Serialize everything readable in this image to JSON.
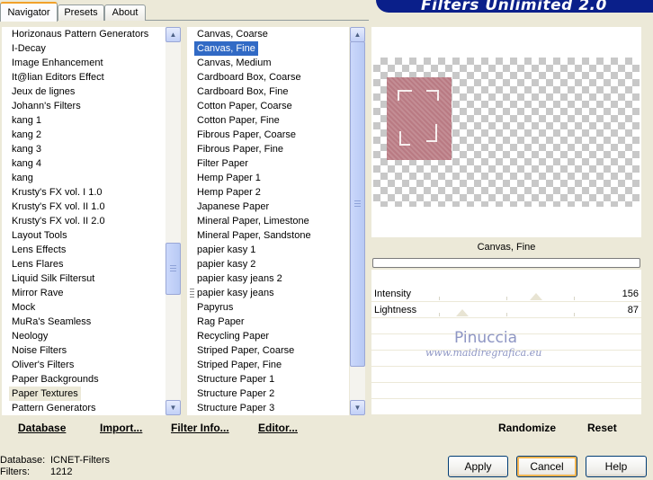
{
  "tabs": [
    {
      "label": "Navigator",
      "active": true
    },
    {
      "label": "Presets",
      "active": false
    },
    {
      "label": "About",
      "active": false
    }
  ],
  "banner_title": "Filters Unlimited 2.0",
  "categories": {
    "items": [
      "Horizonaus Pattern Generators",
      "I-Decay",
      "Image Enhancement",
      "It@lian Editors Effect",
      "Jeux de lignes",
      "Johann's Filters",
      "kang 1",
      "kang 2",
      "kang 3",
      "kang 4",
      "kang",
      "Krusty's FX vol. I 1.0",
      "Krusty's FX vol. II 1.0",
      "Krusty's FX vol. II 2.0",
      "Layout Tools",
      "Lens Effects",
      "Lens Flares",
      "Liquid Silk Filtersut",
      "Mirror Rave",
      "Mock",
      "MuRa's Seamless",
      "Neology",
      "Noise Filters",
      "Oliver's Filters",
      "Paper Backgrounds",
      "Paper Textures",
      "Pattern Generators"
    ],
    "selected": "Paper Textures"
  },
  "filters": {
    "items": [
      "Canvas, Coarse",
      "Canvas, Fine",
      "Canvas, Medium",
      "Cardboard Box, Coarse",
      "Cardboard Box, Fine",
      "Cotton Paper, Coarse",
      "Cotton Paper, Fine",
      "Fibrous Paper, Coarse",
      "Fibrous Paper, Fine",
      "Filter Paper",
      "Hemp Paper 1",
      "Hemp Paper 2",
      "Japanese Paper",
      "Mineral Paper, Limestone",
      "Mineral Paper, Sandstone",
      "papier kasy 1",
      "papier kasy 2",
      "papier kasy jeans 2",
      "papier kasy jeans",
      "Papyrus",
      "Rag Paper",
      "Recycling Paper",
      "Striped Paper, Coarse",
      "Striped Paper, Fine",
      "Structure Paper 1",
      "Structure Paper 2",
      "Structure Paper 3"
    ],
    "selected": "Canvas, Fine"
  },
  "bottom_links": {
    "database": "Database",
    "import": "Import...",
    "filter_info": "Filter Info...",
    "editor": "Editor...",
    "randomize": "Randomize",
    "reset": "Reset"
  },
  "preview": {
    "filter_name": "Canvas, Fine"
  },
  "parameters": [
    {
      "label": "Intensity",
      "value": "156"
    },
    {
      "label": "Lightness",
      "value": "87"
    }
  ],
  "watermark": {
    "name": "Pinuccia",
    "site": "www.maidiregrafica.eu"
  },
  "status": {
    "database_label": "Database:",
    "database_value": "ICNET-Filters",
    "filters_label": "Filters:",
    "filters_value": "1212"
  },
  "buttons": {
    "apply": "Apply",
    "cancel": "Cancel",
    "help": "Help"
  },
  "icons": {
    "scroll_up": "triangle-up-icon",
    "scroll_down": "triangle-down-icon",
    "slider_thumb": "triangle-thumb-icon"
  },
  "colors": {
    "selection_blue": "#316ac5",
    "banner_blue": "#0a1f8a",
    "default_button_ring": "#f8b651"
  }
}
